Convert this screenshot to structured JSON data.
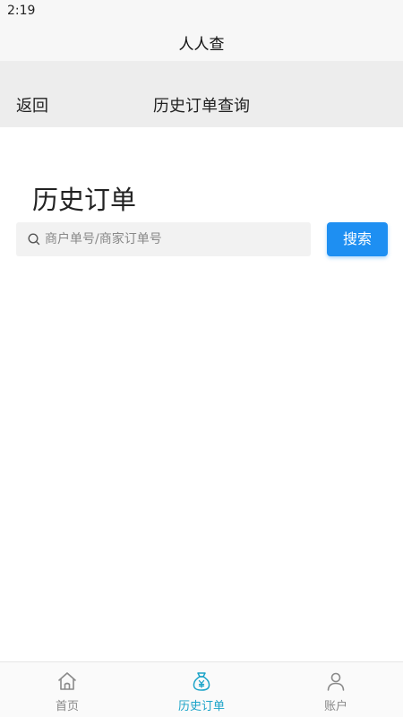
{
  "status_bar": {
    "time": "2:19"
  },
  "app": {
    "title": "人人查"
  },
  "nav": {
    "back_label": "返回",
    "title": "历史订单查询"
  },
  "main": {
    "heading": "历史订单",
    "search": {
      "placeholder": "商户单号/商家订单号",
      "value": "",
      "button_label": "搜索"
    }
  },
  "tab_bar": {
    "active_color": "#1aa3c8",
    "inactive_color": "#888888",
    "tabs": [
      {
        "label": "首页",
        "icon": "home-icon",
        "active": false
      },
      {
        "label": "历史订单",
        "icon": "money-bag-icon",
        "active": true
      },
      {
        "label": "账户",
        "icon": "user-icon",
        "active": false
      }
    ]
  },
  "colors": {
    "primary_button": "#1e8ff2",
    "nav_background": "#ededed"
  }
}
